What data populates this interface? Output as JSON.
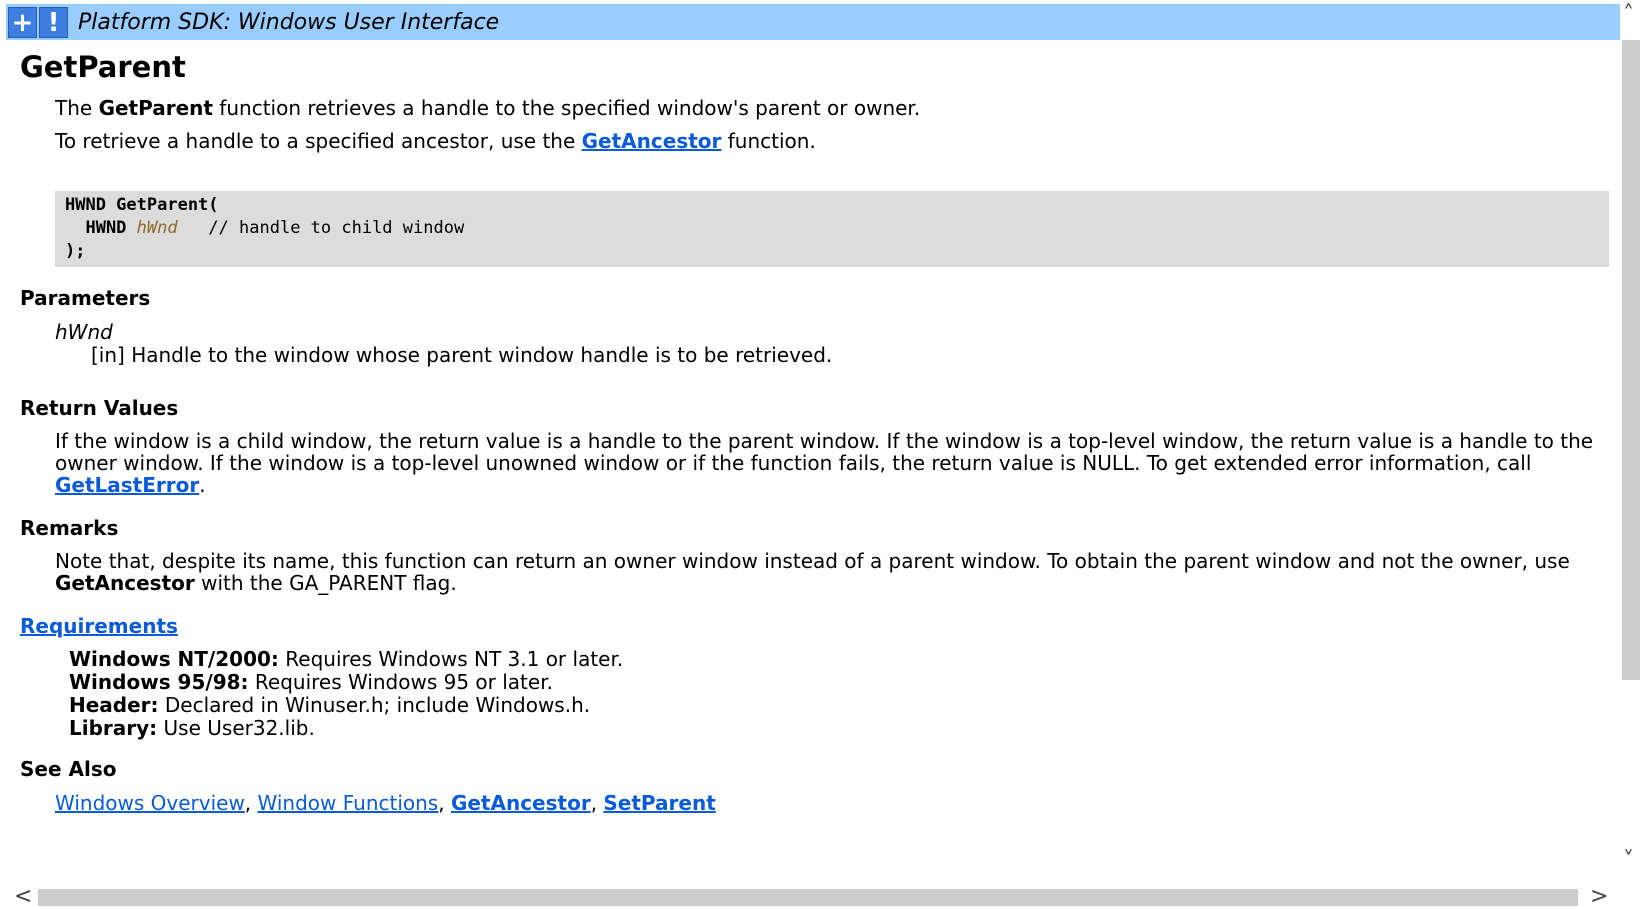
{
  "header": {
    "title": "Platform SDK: Windows User Interface",
    "expand_button": "+",
    "alert_button": "!"
  },
  "page": {
    "title": "GetParent",
    "intro_pre": "The ",
    "intro_bold": "GetParent",
    "intro_post": " function retrieves a handle to the specified window's parent or owner.",
    "ancestor_pre": "To retrieve a handle to a specified ancestor, use the ",
    "ancestor_link": "GetAncestor",
    "ancestor_post": " function."
  },
  "code": {
    "line1": "HWND GetParent(",
    "line2_type": "  HWND ",
    "line2_param": "hWnd",
    "line2_comment": "   // handle to child window",
    "line3": ");"
  },
  "parameters": {
    "heading": "Parameters",
    "name": "hWnd",
    "desc": "[in] Handle to the window whose parent window handle is to be retrieved."
  },
  "return_values": {
    "heading": "Return Values",
    "line1": "If the window is a child window, the return value is a handle to the parent window. If the window is a top-level window, the return value is a handle to the",
    "line2": "owner window. If the window is a top-level unowned window or if the function fails, the return value is NULL. To get extended error information, call",
    "link": "GetLastError",
    "after_link": "."
  },
  "remarks": {
    "heading": "Remarks",
    "line1": "Note that, despite its name, this function can return an owner window instead of a parent window. To obtain the parent window and not the owner, use",
    "line2_bold": "GetAncestor",
    "line2_rest": " with the GA_PARENT flag."
  },
  "requirements": {
    "heading": "Requirements",
    "rows": [
      {
        "label": "Windows NT/2000:",
        "value": " Requires Windows NT 3.1 or later."
      },
      {
        "label": "Windows 95/98:",
        "value": " Requires Windows 95 or later."
      },
      {
        "label": "Header:",
        "value": " Declared in Winuser.h; include Windows.h."
      },
      {
        "label": "Library:",
        "value": " Use User32.lib."
      }
    ]
  },
  "see_also": {
    "heading": "See Also",
    "links": [
      "Windows Overview",
      "Window Functions",
      "GetAncestor",
      "SetParent"
    ],
    "separator": ", "
  },
  "scrollbars": {
    "up_arrow": "˄",
    "down_arrow": "˅",
    "left_arrow": "<",
    "right_arrow": ">"
  },
  "colors": {
    "header_bg": "#99ccff",
    "link": "#0a5bd9",
    "code_bg": "#dcdcdc",
    "param_color": "#8a6a2a"
  }
}
